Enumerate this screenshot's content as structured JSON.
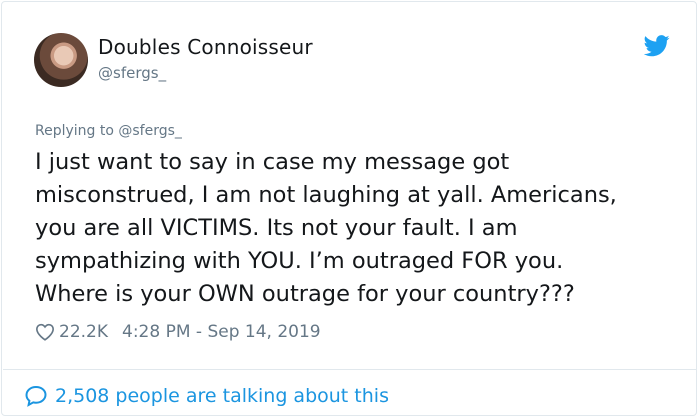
{
  "author": {
    "display_name": "Doubles Connoisseur",
    "handle": "@sfergs_"
  },
  "tweet": {
    "replying_to": "Replying to @sfergs_",
    "lines": [
      "I just want to say in case my message got",
      "misconstrued, I am not laughing at yall. Americans,",
      "you are all VICTIMS. Its not your fault. I am",
      "sympathizing with YOU. I’m outraged FOR you.",
      "Where is your OWN outrage for your country???"
    ],
    "likes": "22.2K",
    "timestamp": "4:28 PM - Sep 14, 2019"
  },
  "footer": {
    "talking_text": "2,508 people are talking about this"
  },
  "icons": {
    "brand": "twitter-bird-icon",
    "like": "heart-outline-icon",
    "conversation": "speech-bubble-icon"
  },
  "colors": {
    "twitter_blue": "#1da1f2",
    "link_blue": "#1b95e0",
    "secondary_text": "#657786",
    "primary_text": "#14171a",
    "border": "#e1e8ed"
  }
}
